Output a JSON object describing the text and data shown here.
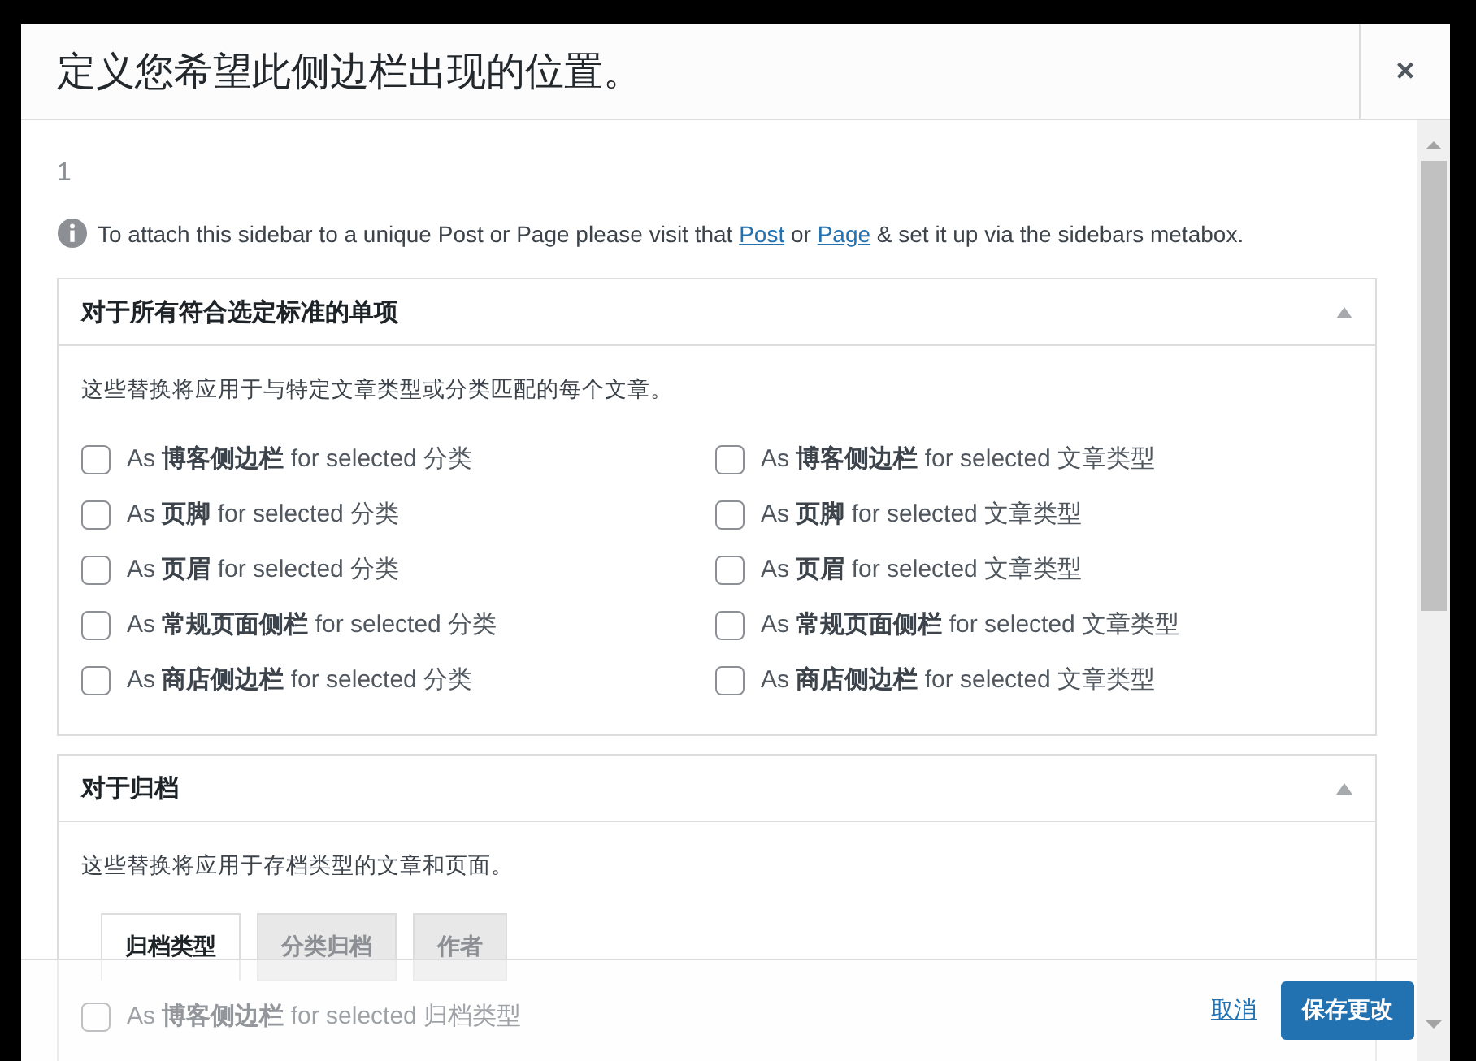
{
  "dialog": {
    "title": "定义您希望此侧边栏出现的位置。",
    "close": "×"
  },
  "body": {
    "number": "1",
    "notice": [
      {
        "kind": "text",
        "text": "To attach this sidebar to a unique Post or Page please visit that "
      },
      {
        "kind": "link",
        "text": "Post"
      },
      {
        "kind": "text",
        "text": " or "
      },
      {
        "kind": "link",
        "text": "Page"
      },
      {
        "kind": "text",
        "text": " & set it up via the sidebars metabox."
      }
    ]
  },
  "panels": [
    {
      "title": "对于所有符合选定标准的单项",
      "expanded": true,
      "description": "这些替换将应用于与特定文章类型或分类匹配的每个文章。",
      "options": [
        {
          "label": "As **博客侧边栏** for selected 分类",
          "checked": false
        },
        {
          "label": "As **博客侧边栏** for selected 文章类型",
          "checked": false
        },
        {
          "label": "As **页脚** for selected 分类",
          "checked": false
        },
        {
          "label": "As **页脚** for selected 文章类型",
          "checked": false
        },
        {
          "label": "As **页眉** for selected 分类",
          "checked": false
        },
        {
          "label": "As **页眉** for selected 文章类型",
          "checked": false
        },
        {
          "label": "As **常规页面侧栏** for selected 分类",
          "checked": false
        },
        {
          "label": "As **常规页面侧栏** for selected 文章类型",
          "checked": false
        },
        {
          "label": "As **商店侧边栏** for selected 分类",
          "checked": false
        },
        {
          "label": "As **商店侧边栏** for selected 文章类型",
          "checked": false
        }
      ]
    },
    {
      "title": "对于归档",
      "expanded": true,
      "description": "这些替换将应用于存档类型的文章和页面。",
      "tabs": [
        {
          "label": "归档类型",
          "selected": true
        },
        {
          "label": "分类归档",
          "selected": false
        },
        {
          "label": "作者",
          "selected": false
        }
      ],
      "options": [
        {
          "label": "As **博客侧边栏** for selected 归档类型",
          "checked": false
        }
      ]
    }
  ],
  "footer": {
    "cancel": "取消",
    "save": "保存更改"
  }
}
